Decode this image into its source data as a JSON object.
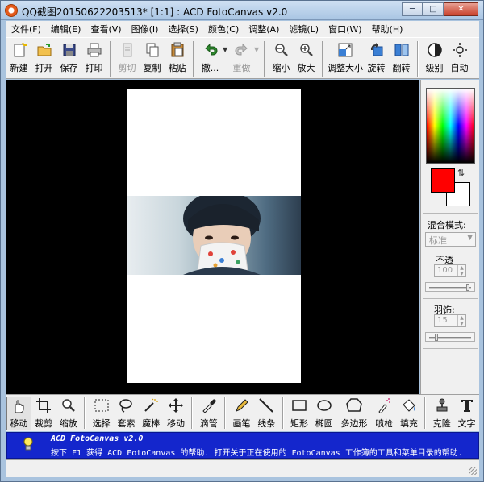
{
  "window": {
    "title": "QQ截图20150622203513* [1:1] : ACD FotoCanvas v2.0",
    "minimize_glyph": "─",
    "maximize_glyph": "□",
    "close_glyph": "✕"
  },
  "menubar": {
    "items": [
      {
        "label": "文件(F)"
      },
      {
        "label": "编辑(E)"
      },
      {
        "label": "查看(V)"
      },
      {
        "label": "图像(I)"
      },
      {
        "label": "选择(S)"
      },
      {
        "label": "颜色(C)"
      },
      {
        "label": "调整(A)"
      },
      {
        "label": "滤镜(L)"
      },
      {
        "label": "窗口(W)"
      },
      {
        "label": "帮助(H)"
      }
    ]
  },
  "toolbar": {
    "new": "新建",
    "open": "打开",
    "save": "保存",
    "print": "打印",
    "cut": "剪切",
    "copy": "复制",
    "paste": "粘贴",
    "undo": "撤...",
    "redo": "重做",
    "zoom_out": "缩小",
    "zoom_in": "放大",
    "resize": "调整大小",
    "rotate": "旋转",
    "flip": "翻转",
    "levels": "级别",
    "auto": "自动"
  },
  "right_panel": {
    "primary_color": "#ff0000",
    "secondary_color": "#ffffff",
    "blend_mode_label": "混合模式:",
    "blend_mode_value": "标准",
    "opacity_label": "不透",
    "opacity_value": "100",
    "opacity_slider_fraction": 1.0,
    "feather_label": "羽饰:",
    "feather_value": "15",
    "feather_slider_fraction": 0.15
  },
  "tools": {
    "move": "移动",
    "crop": "裁剪",
    "zoom": "缩放",
    "select": "选择",
    "lasso": "套索",
    "magic_wand": "魔棒",
    "move2": "移动",
    "dropper": "滴管",
    "pencil": "画笔",
    "line": "线条",
    "rectangle": "矩形",
    "ellipse": "椭圆",
    "polygon": "多边形",
    "airbrush": "喷枪",
    "fill": "填充",
    "clone": "克隆",
    "text": "文字"
  },
  "statusbar": {
    "title": "ACD FotoCanvas v2.0",
    "message": "按下 F1 获得 ACD FotoCanvas 的帮助. 打开关于正在使用的 FotoCanvas 工作簿的工具和菜单目录的帮助."
  }
}
